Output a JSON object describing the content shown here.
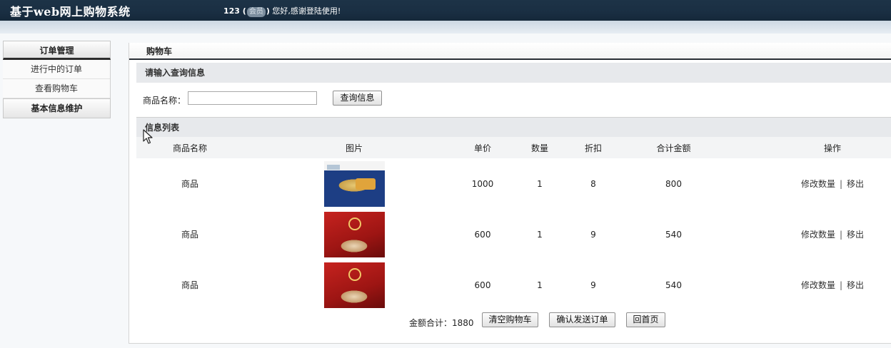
{
  "header": {
    "app_title": "基于web网上购物系统",
    "user_name": "123",
    "user_role": "会员",
    "greeting": "您好,感谢登陆使用!"
  },
  "sidebar": {
    "groups": [
      {
        "title": "订单管理",
        "items": [
          {
            "label": "进行中的订单"
          },
          {
            "label": "查看购物车"
          }
        ]
      },
      {
        "title": "基本信息维护"
      }
    ]
  },
  "main": {
    "panel_title": "购物车",
    "search": {
      "section_title": "请输入查询信息",
      "field_label": "商品名称：",
      "field_value": "",
      "button_label": "查询信息"
    },
    "list": {
      "section_title": "信息列表",
      "columns": [
        "商品名称",
        "图片",
        "单价",
        "数量",
        "折扣",
        "合计金额",
        "操作"
      ],
      "rows": [
        {
          "name": "商品",
          "image": "biscuit-tin-image",
          "price": "1000",
          "qty": "1",
          "discount": "8",
          "total": "800",
          "op_edit": "修改数量",
          "op_remove": "移出"
        },
        {
          "name": "商品",
          "image": "gift-box-image",
          "price": "600",
          "qty": "1",
          "discount": "9",
          "total": "540",
          "op_edit": "修改数量",
          "op_remove": "移出"
        },
        {
          "name": "商品",
          "image": "gift-box-image",
          "price": "600",
          "qty": "1",
          "discount": "9",
          "total": "540",
          "op_edit": "修改数量",
          "op_remove": "移出"
        }
      ],
      "separator": "|"
    },
    "footer": {
      "sum_label": "金额合计：1880",
      "clear_cart": "清空购物车",
      "confirm_order": "确认发送订单",
      "home": "回首页"
    }
  },
  "colors": {
    "topbar": "#1d3347",
    "section_header_bg": "#e7e9ec",
    "panel_title_border": "#2a2f35"
  }
}
